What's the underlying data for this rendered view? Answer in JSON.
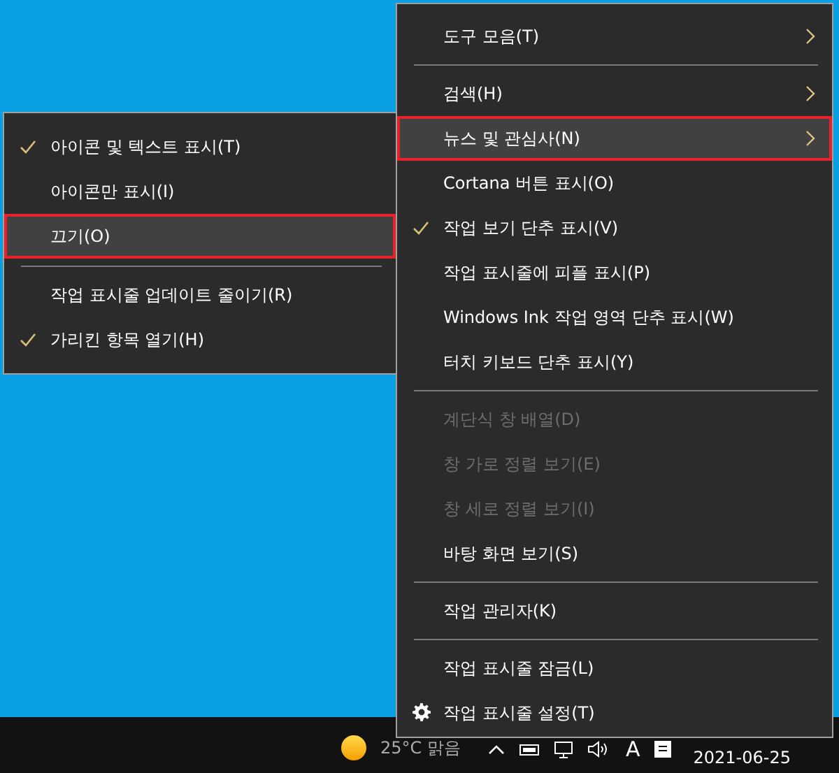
{
  "submenu": {
    "items": [
      {
        "kind": "item",
        "label": "아이콘 및 텍스트 표시(T)",
        "checked": true,
        "selected": false
      },
      {
        "kind": "item",
        "label": "아이콘만 표시(I)",
        "checked": false,
        "selected": false
      },
      {
        "kind": "item",
        "label": "끄기(O)",
        "checked": false,
        "selected": true
      },
      {
        "kind": "separator"
      },
      {
        "kind": "item",
        "label": "작업 표시줄 업데이트 줄이기(R)",
        "checked": false,
        "selected": false
      },
      {
        "kind": "item",
        "label": "가리킨 항목 열기(H)",
        "checked": true,
        "selected": false
      }
    ]
  },
  "context_menu": {
    "items": [
      {
        "kind": "item",
        "label": "도구 모음(T)",
        "submenu": true,
        "selected": false
      },
      {
        "kind": "separator"
      },
      {
        "kind": "item",
        "label": "검색(H)",
        "submenu": true,
        "selected": false
      },
      {
        "kind": "item",
        "label": "뉴스 및 관심사(N)",
        "submenu": true,
        "selected": true
      },
      {
        "kind": "item",
        "label": "Cortana 버튼 표시(O)",
        "selected": false
      },
      {
        "kind": "item",
        "label": "작업 보기 단추 표시(V)",
        "checked": true,
        "selected": false
      },
      {
        "kind": "item",
        "label": "작업 표시줄에 피플 표시(P)",
        "selected": false
      },
      {
        "kind": "item",
        "label": "Windows Ink 작업 영역 단추 표시(W)",
        "selected": false
      },
      {
        "kind": "item",
        "label": "터치 키보드 단추 표시(Y)",
        "selected": false
      },
      {
        "kind": "separator"
      },
      {
        "kind": "item",
        "label": "계단식 창 배열(D)",
        "disabled": true,
        "selected": false
      },
      {
        "kind": "item",
        "label": "창 가로 정렬 보기(E)",
        "disabled": true,
        "selected": false
      },
      {
        "kind": "item",
        "label": "창 세로 정렬 보기(I)",
        "disabled": true,
        "selected": false
      },
      {
        "kind": "item",
        "label": "바탕 화면 보기(S)",
        "selected": false
      },
      {
        "kind": "separator"
      },
      {
        "kind": "item",
        "label": "작업 관리자(K)",
        "selected": false
      },
      {
        "kind": "separator"
      },
      {
        "kind": "item",
        "label": "작업 표시줄 잠금(L)",
        "selected": false
      },
      {
        "kind": "gear_item",
        "label": "작업 표시줄 설정(T)",
        "selected": false
      }
    ]
  },
  "taskbar": {
    "weather": "25°C 맑음",
    "input_indicator": "A",
    "date": "2021-06-25"
  }
}
